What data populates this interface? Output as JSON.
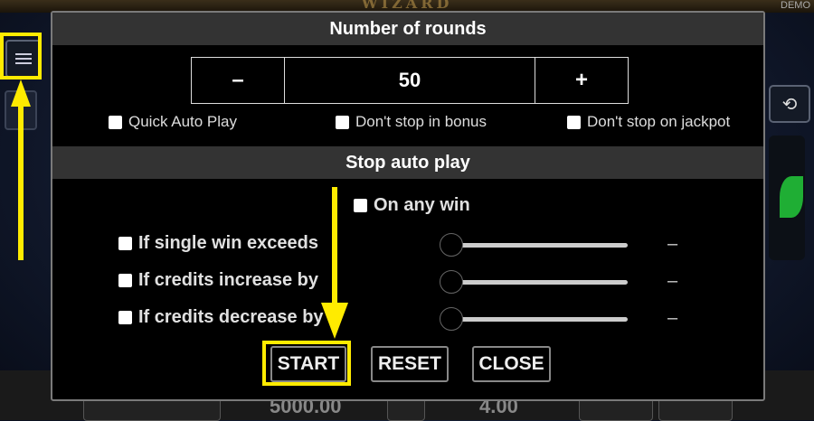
{
  "app": {
    "demo_label": "DEMO",
    "logo_text": "WIZARD"
  },
  "rounds_section": {
    "title": "Number of rounds",
    "minus_label": "–",
    "value": "50",
    "plus_label": "+",
    "options": [
      {
        "label": "Quick Auto Play"
      },
      {
        "label": "Don't stop in bonus"
      },
      {
        "label": "Don't stop on jackpot"
      }
    ]
  },
  "stop_section": {
    "title": "Stop auto play",
    "any_win_label": "On any win",
    "conditions": [
      {
        "label": "If single win exceeds",
        "value": "–"
      },
      {
        "label": "If credits increase by",
        "value": "–"
      },
      {
        "label": "If credits decrease by",
        "value": "–"
      }
    ]
  },
  "actions": {
    "start": "START",
    "reset": "RESET",
    "close": "CLOSE"
  },
  "background": {
    "bottom_left": "5000.00",
    "bottom_right": "4.00"
  },
  "colors": {
    "highlight": "#ffeb00",
    "panel_header": "#333333",
    "dialog_bg": "#000000"
  },
  "icons": {
    "menu": "hamburger-menu-icon",
    "history": "history-icon"
  }
}
